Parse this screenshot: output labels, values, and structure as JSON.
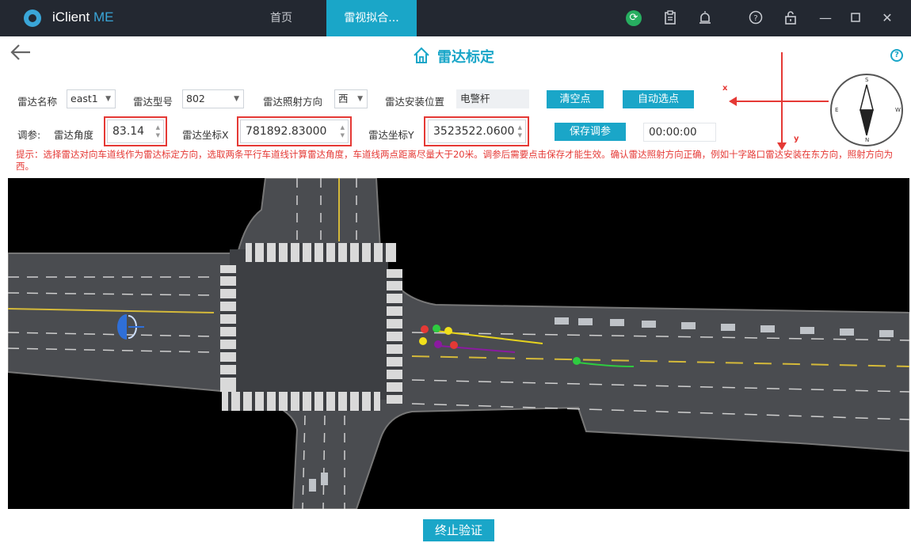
{
  "app": {
    "name": "iClient",
    "name_suffix": "ME"
  },
  "tabs": [
    {
      "label": "首页"
    },
    {
      "label": "雷视拟合..."
    }
  ],
  "page": {
    "title": "雷达标定"
  },
  "form": {
    "radar_name_label": "雷达名称",
    "radar_name_value": "east1",
    "radar_model_label": "雷达型号",
    "radar_model_value": "802",
    "direction_label": "雷达照射方向",
    "direction_value": "西",
    "location_label": "雷达安装位置",
    "location_value": "电警杆",
    "clear_points_btn": "清空点",
    "auto_select_btn": "自动选点",
    "tune_label": "调参:",
    "angle_label": "雷达角度",
    "angle_value": "83.14",
    "coord_x_label": "雷达坐标X",
    "coord_x_value": "781892.83000",
    "coord_y_label": "雷达坐标Y",
    "coord_y_value": "3523522.0600",
    "save_tune_btn": "保存调参",
    "time_value": "00:00:00"
  },
  "hint": "提示：选择雷达对向车道线作为雷达标定方向，选取两条平行车道线计算雷达角度，车道线两点距离尽量大于20米。调参后需要点击保存才能生效。确认雷达照射方向正确，例如十字路口雷达安装在东方向，照射方向为西。",
  "compass": {
    "x_label": "x",
    "y_label": "y",
    "n": "N",
    "s": "S",
    "e": "E",
    "w": "W"
  },
  "bottom": {
    "stop_btn": "终止验证"
  },
  "colors": {
    "accent": "#1aa6c8",
    "titlebar": "#232831",
    "warning": "#e53935"
  }
}
